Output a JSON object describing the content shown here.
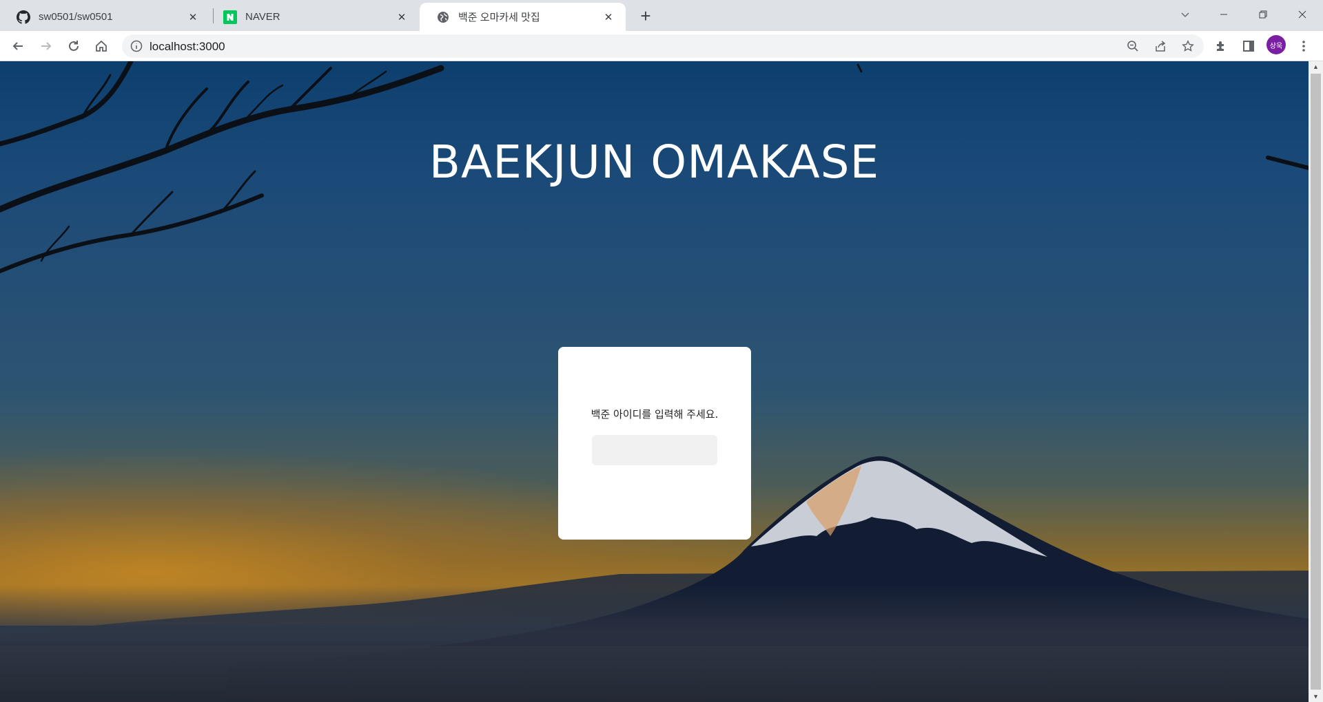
{
  "browser": {
    "tabs": [
      {
        "title": "sw0501/sw0501",
        "icon": "github-icon",
        "active": false
      },
      {
        "title": "NAVER",
        "icon": "naver-icon",
        "active": false
      },
      {
        "title": "백준 오마카세 맛집",
        "icon": "globe-icon",
        "active": true
      }
    ],
    "address": {
      "url": "localhost:3000"
    },
    "profile": {
      "initials": "상욱",
      "color": "#7b1fa2"
    }
  },
  "page": {
    "title": "BAEKJUN OMAKASE",
    "login": {
      "prompt": "백준 아이디를 입력해 주세요.",
      "input_value": "",
      "input_placeholder": ""
    }
  },
  "colors": {
    "naver_green": "#03c75a",
    "sky_top": "#0d3f6e",
    "horizon_glow": "#c48723"
  }
}
